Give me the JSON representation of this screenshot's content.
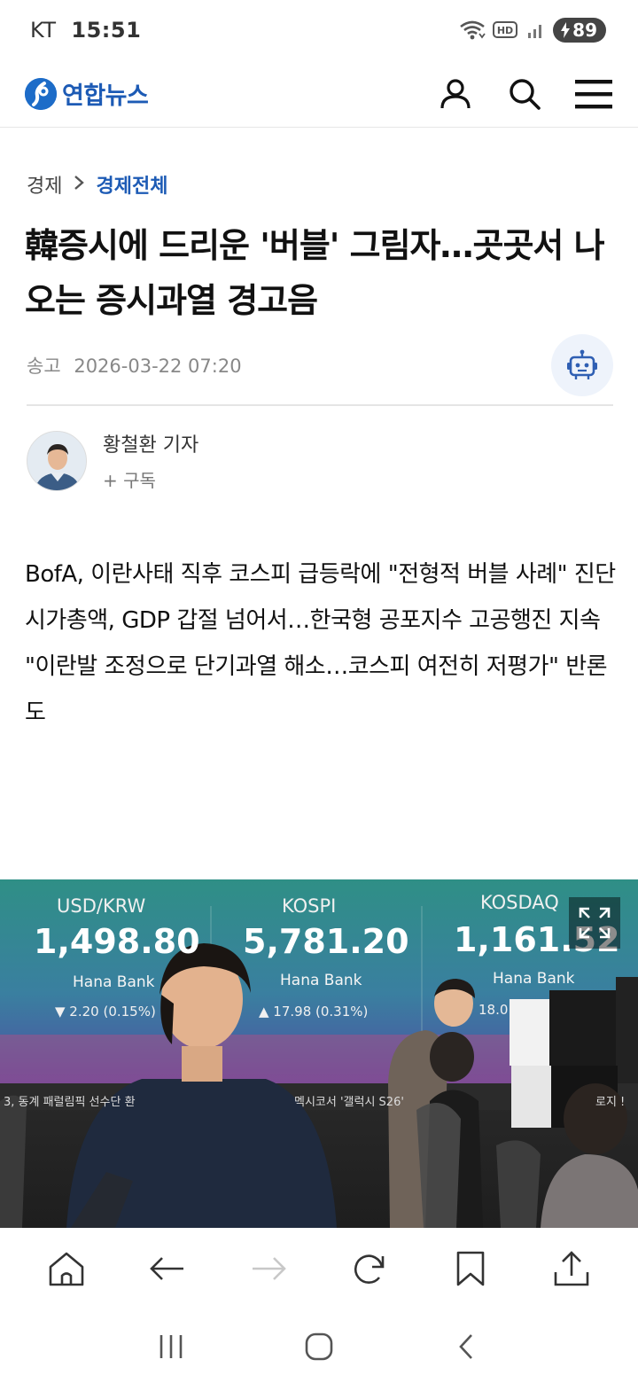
{
  "status_bar": {
    "carrier": "KT",
    "time": "15:51",
    "hd_label": "HD",
    "battery": "89"
  },
  "header": {
    "logo_text": "연합뉴스",
    "logo_mark": "Y",
    "brand_color": "#1d5bb5",
    "icons": [
      "user-icon",
      "search-icon",
      "menu-icon"
    ]
  },
  "breadcrumb": {
    "section": "경제",
    "subsection": "경제전체",
    "separator": ">"
  },
  "article": {
    "title": "韓증시에 드리운 '버블' 그림자…곳곳서 나오는 증시과열 경고음",
    "sent_label": "송고",
    "date": "2026-03-22 07:20",
    "author_name": "황철환 기자",
    "subscribe_label": "+ 구독",
    "summary": [
      "BofA, 이란사태 직후 코스피 급등락에 \"전형적 버블 사례\" 진단",
      "시가총액, GDP 갑절 넘어서…한국형 공포지수 고공행진 지속",
      "\"이란발 조정으로 단기과열 해소…코스피 여전히 저평가\" 반론도"
    ]
  },
  "photo": {
    "boards": [
      {
        "label": "USD/KRW",
        "value": "1,498.80",
        "bank": "Hana Bank",
        "change": "▼ 2.20 (0.15%)"
      },
      {
        "label": "KOSPI",
        "value": "5,781.20",
        "bank": "Hana Bank",
        "change": "▲ 17.98 (0.31%)"
      },
      {
        "label": "KOSDAQ",
        "value": "1,161.52",
        "bank": "Hana Bank",
        "change": "18.0"
      }
    ],
    "ticker_left": "3, 동계 패럴림픽 선수단 환",
    "ticker_right": "멕시코서 '갤럭시 S26'",
    "ticker_far": "로지 !"
  },
  "browser_toolbar": [
    "home-icon",
    "back-icon",
    "forward-icon",
    "reload-icon",
    "bookmark-icon",
    "share-icon"
  ],
  "system_nav": [
    "recents-icon",
    "home-nav-icon",
    "back-nav-icon"
  ]
}
